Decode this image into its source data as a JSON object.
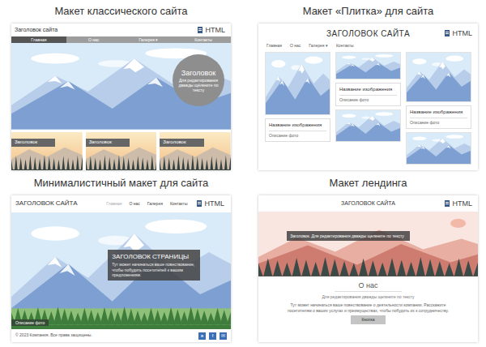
{
  "panels": [
    {
      "kind": "classic",
      "caption": "Макет классического сайта",
      "site_title": "Заголовок сайта",
      "badge": "HTML",
      "nav": [
        {
          "label": "Главная",
          "selected": true
        },
        {
          "label": "О нас",
          "selected": false
        },
        {
          "label": "Галерея ▾",
          "selected": false
        },
        {
          "label": "Контакты",
          "selected": false
        }
      ],
      "hero": {
        "title": "Заголовок",
        "text": "Для редактирования дважды щёлкните по тексту"
      },
      "thumbs": [
        "Заголовок",
        "Заголовок",
        "Заголовок"
      ]
    },
    {
      "kind": "tiles",
      "caption": "Макет «Плитка» для сайта",
      "site_title": "ЗАГОЛОВОК САЙТА",
      "badge": "HTML",
      "nav": [
        "Главная",
        "О нас",
        "Галерея ▾",
        "Контакты"
      ],
      "columns": [
        [
          {
            "kind": "image"
          },
          {
            "kind": "card",
            "title": "Название изображения",
            "text": "Описание фото"
          }
        ],
        [
          {
            "kind": "image"
          },
          {
            "kind": "card",
            "title": "Название изображения",
            "text": "Описание фото"
          },
          {
            "kind": "image"
          }
        ],
        [
          {
            "kind": "image"
          },
          {
            "kind": "card",
            "title": "Название изображения",
            "text": "Описание фото"
          },
          {
            "kind": "image"
          }
        ]
      ]
    },
    {
      "kind": "minimal",
      "caption": "Минималистичный макет для сайта",
      "site_title": "ЗАГОЛОВОК САЙТА",
      "badge": "HTML",
      "nav": [
        {
          "label": "Главная",
          "selected": true
        },
        {
          "label": "О нас",
          "selected": false
        },
        {
          "label": "Галерея",
          "selected": false
        },
        {
          "label": "Контакты",
          "selected": false
        }
      ],
      "hero": {
        "title": "ЗАГОЛОВОК СТРАНИЦЫ",
        "text": "Тут может начинаться ваше повествование, чтобы побудить посетителей к вашим предложениям.",
        "photo_caption": "Описание фото"
      },
      "footer": {
        "copyright": "© 2023 Компания. Все права защищены.",
        "social": [
          "в",
          "f",
          "✉"
        ]
      }
    },
    {
      "kind": "landing",
      "caption": "Макет лендинга",
      "site_title": "ЗАГОЛОВОК САЙТА",
      "badge": "HTML",
      "hero": {
        "text": "Заголовок. Для редактирования дважды щелкните по тексту"
      },
      "about": {
        "title": "О нас",
        "subtitle": "Для редактирования дважды щелкните по тексту",
        "text": "Тут может начинаться ваше повествование о деятельности компании. Расскажите посетителям о ваших услугах и преимуществах, чтобы побудить их к сотрудничеству.",
        "button": "Кнопка"
      }
    }
  ]
}
